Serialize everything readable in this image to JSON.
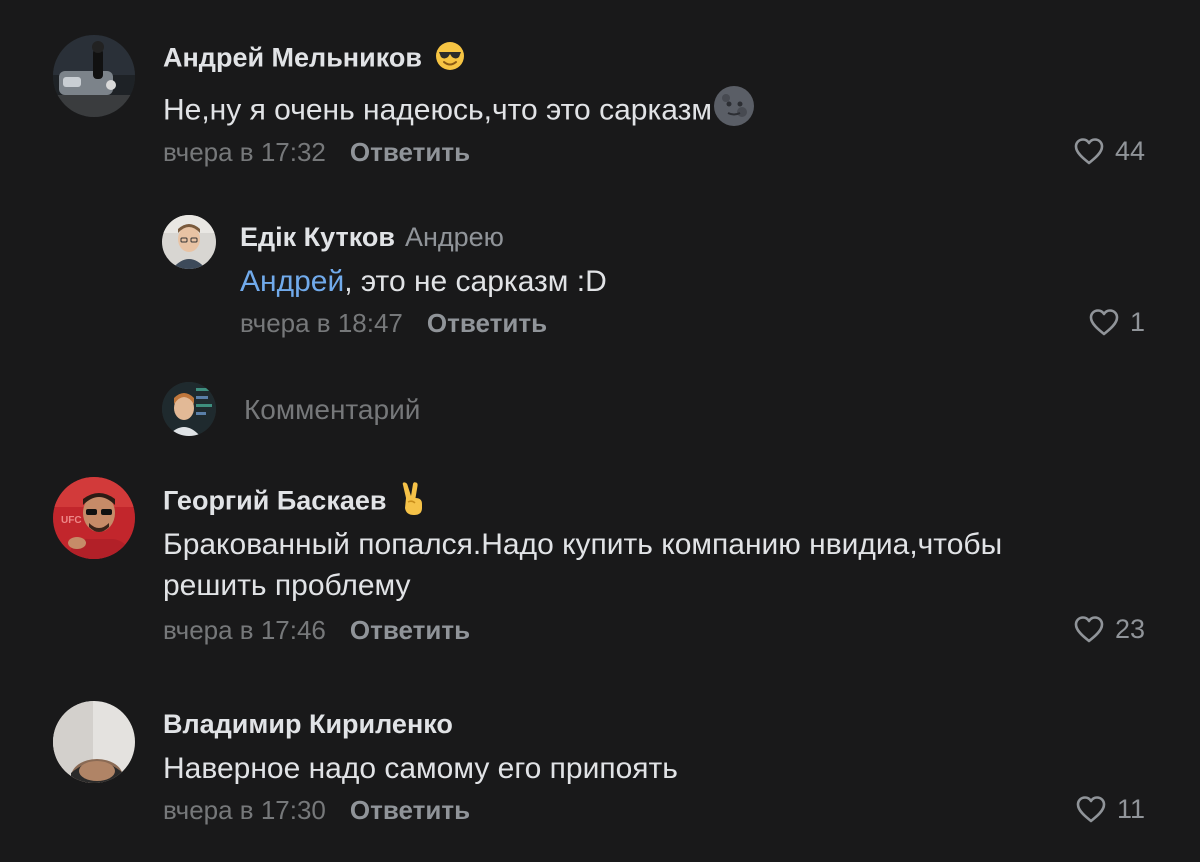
{
  "comments": [
    {
      "author": "Андрей Мельников",
      "text": "Не,ну я очень надеюсь,что это сарказм",
      "time": "вчера в 17:32",
      "reply_label": "Ответить",
      "likes": "44",
      "emoji_name": "sunglasses-emoji",
      "text_emoji_name": "new-moon-face-emoji"
    },
    {
      "author": "Едік Кутков",
      "reply_to": "Андрею",
      "mention": "Андрей",
      "text": ", это не сарказм :D",
      "time": "вчера в 18:47",
      "reply_label": "Ответить",
      "likes": "1"
    },
    {
      "author": "Георгий Баскаев",
      "text_line1": "Бракованный попался.Надо купить компанию нвидиа,чтобы",
      "text_line2": "решить проблему",
      "time": "вчера в 17:46",
      "reply_label": "Ответить",
      "likes": "23",
      "emoji_name": "victory-hand-emoji"
    },
    {
      "author": "Владимир Кириленко",
      "text": "Наверное надо самому его припоять",
      "time": "вчера в 17:30",
      "reply_label": "Ответить",
      "likes": "11"
    }
  ],
  "composer": {
    "placeholder": "Комментарий"
  },
  "colors": {
    "background": "#19191a",
    "text_primary": "#e1e3e6",
    "text_secondary": "#76787a",
    "mention": "#71aaeb"
  }
}
